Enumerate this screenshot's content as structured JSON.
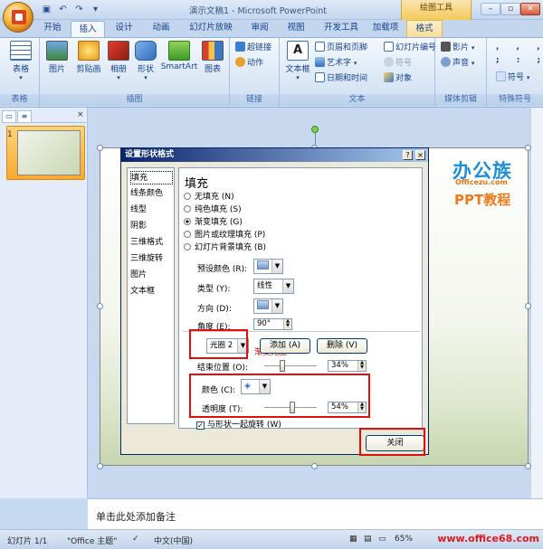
{
  "app": {
    "title": "演示文稿1 - Microsoft PowerPoint",
    "context_tools": "绘图工具"
  },
  "qat": {
    "save_icon": "save-icon",
    "undo_icon": "undo-icon",
    "redo_icon": "redo-icon"
  },
  "tabs": [
    "开始",
    "插入",
    "设计",
    "动画",
    "幻灯片放映",
    "审阅",
    "视图",
    "开发工具",
    "加载项",
    "格式"
  ],
  "ribbon": {
    "groups": {
      "tables": "表格",
      "illustrations": "插图",
      "links": "链接",
      "text": "文本",
      "media": "媒体剪辑",
      "symbols": "特殊符号"
    },
    "buttons": {
      "table": "表格",
      "picture": "图片",
      "clipart": "剪贴画",
      "album": "相册",
      "shapes": "形状",
      "smartart": "SmartArt",
      "chart": "图表",
      "hyperlink": "超链接",
      "action": "动作",
      "textbox": "文本框",
      "header_footer": "页眉和页脚",
      "wordart": "艺术字",
      "datetime": "日期和时间",
      "slide_number": "幻灯片编号",
      "symbol": "符号",
      "object": "对象",
      "movie": "影片",
      "sound": "声音",
      "special_symbol": "符号"
    }
  },
  "slides_panel": {
    "slide_number": "1"
  },
  "brand": {
    "line1": "办公族",
    "line2": "Officezu.com",
    "line3": "PPT教程"
  },
  "dialog": {
    "title": "设置形状格式",
    "nav": [
      "填充",
      "线条颜色",
      "线型",
      "阴影",
      "三维格式",
      "三维旋转",
      "图片",
      "文本框"
    ],
    "heading": "填充",
    "fill_options": [
      {
        "label": "无填充 (N)",
        "selected": false
      },
      {
        "label": "纯色填充 (S)",
        "selected": false
      },
      {
        "label": "渐变填充 (G)",
        "selected": true
      },
      {
        "label": "图片或纹理填充 (P)",
        "selected": false
      },
      {
        "label": "幻灯片背景填充 (B)",
        "selected": false
      }
    ],
    "preset_label": "预设颜色 (R):",
    "type_label": "类型 (Y):",
    "type_value": "线性",
    "direction_label": "方向 (D):",
    "angle_label": "角度 (E):",
    "angle_value": "90°",
    "stops_label": "渐变光圈",
    "stop_value": "光圈 2",
    "add_button": "添加 (A)",
    "delete_button": "删除 (V)",
    "end_pos_label": "结束位置 (O):",
    "end_pos_value": "34%",
    "end_pos_level": 0.34,
    "color_label": "颜色 (C):",
    "transparency_label": "透明度 (T):",
    "transparency_value": "54%",
    "transparency_level": 0.54,
    "rotate_label": "与形状一起旋转 (W)",
    "rotate_checked": true,
    "close_button": "关闭"
  },
  "notes": {
    "placeholder": "单击此处添加备注"
  },
  "status": {
    "slide": "幻灯片 1/1",
    "theme": "\"Office 主题\"",
    "language": "中文(中国)",
    "zoom": "65%",
    "watermark": "www.office68.com"
  },
  "colors": {
    "accent_red": "#e10e0e",
    "title_blue": "#0a246a",
    "brand_blue": "#1e8fd6",
    "brand_orange": "#f07a1a"
  }
}
